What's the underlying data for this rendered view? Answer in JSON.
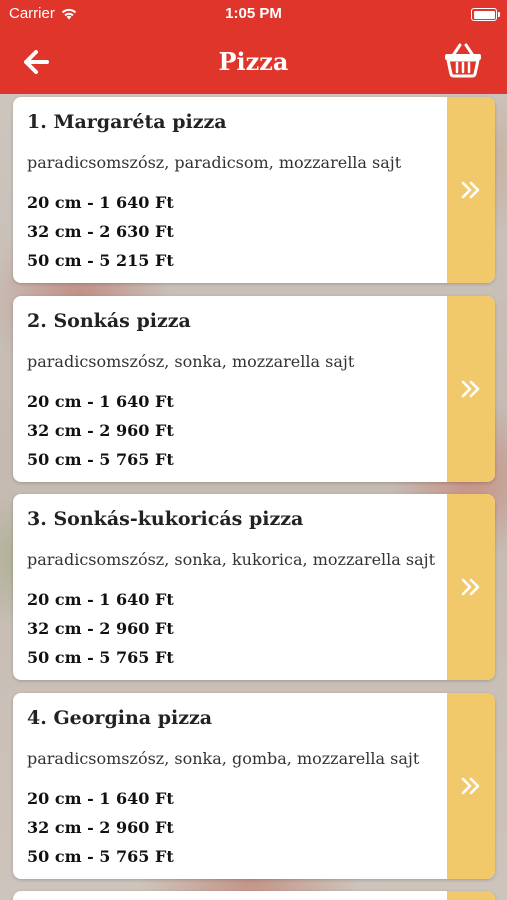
{
  "status_bar": {
    "carrier": "Carrier",
    "time": "1:05 PM"
  },
  "nav": {
    "title": "Pizza",
    "back_icon": "arrow-left-icon",
    "basket_icon": "basket-icon"
  },
  "colors": {
    "header": "#e0352b",
    "accent": "#f1c96a",
    "card": "#ffffff"
  },
  "pizzas": [
    {
      "title": "1. Margaréta pizza",
      "ingredients": "paradicsomszósz, paradicsom, mozzarella sajt",
      "prices": [
        "20 cm - 1 640 Ft",
        "32 cm - 2 630 Ft",
        "50 cm - 5 215 Ft"
      ]
    },
    {
      "title": "2. Sonkás pizza",
      "ingredients": "paradicsomszósz, sonka, mozzarella sajt",
      "prices": [
        "20 cm - 1 640 Ft",
        "32 cm - 2 960 Ft",
        "50 cm - 5 765 Ft"
      ]
    },
    {
      "title": "3. Sonkás-kukoricás pizza",
      "ingredients": "paradicsomszósz, sonka, kukorica, mozzarella sajt",
      "prices": [
        "20 cm - 1 640 Ft",
        "32 cm - 2 960 Ft",
        "50 cm - 5 765 Ft"
      ]
    },
    {
      "title": "4. Georgina pizza",
      "ingredients": "paradicsomszósz, sonka, gomba, mozzarella sajt",
      "prices": [
        "20 cm - 1 640 Ft",
        "32 cm - 2 960 Ft",
        "50 cm - 5 765 Ft"
      ]
    }
  ]
}
